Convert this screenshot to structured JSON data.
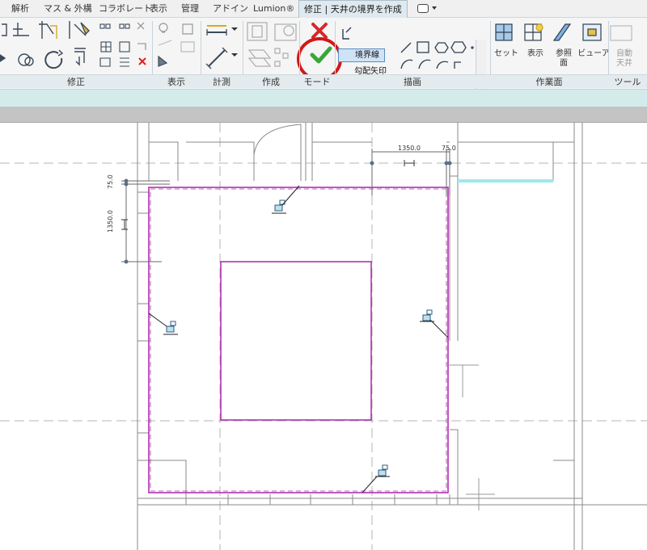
{
  "tabs": [
    {
      "label": "解析",
      "active": false
    },
    {
      "label": "マス & 外構",
      "active": false
    },
    {
      "label": "コラボレート",
      "active": false
    },
    {
      "label": "表示",
      "active": false
    },
    {
      "label": "管理",
      "active": false
    },
    {
      "label": "アドイン",
      "active": false
    },
    {
      "label": "Lumion®",
      "active": false
    },
    {
      "label": "修正 | 天井の境界を作成",
      "active": true
    }
  ],
  "ribbon": {
    "panels": {
      "modify": "修正",
      "view": "表示",
      "measure": "計測",
      "create": "作成",
      "mode": "モード",
      "draw": "描画",
      "workplane": "作業面",
      "tools": "ツール"
    },
    "draw": {
      "boundary_line": "境界線",
      "slope_arrow": "勾配矢印"
    },
    "workplane": {
      "set": "セット",
      "show": "表示",
      "ref_plane": "参照面",
      "viewer": "ビューア"
    },
    "tools": {
      "auto_ceiling": "自動天井"
    },
    "mode": {
      "cancel_icon": "red-x-icon",
      "finish_icon": "green-check-icon"
    }
  },
  "canvas": {
    "dims": {
      "horizontal_main": "1350.0",
      "horizontal_small": "75.0",
      "vertical_main": "1350.0",
      "vertical_small": "75.0"
    },
    "colors": {
      "boundary": "#b030b0",
      "highlight": "#9ee8ee",
      "annotation_circle": "#d01818",
      "check_green": "#3aa63a"
    }
  }
}
